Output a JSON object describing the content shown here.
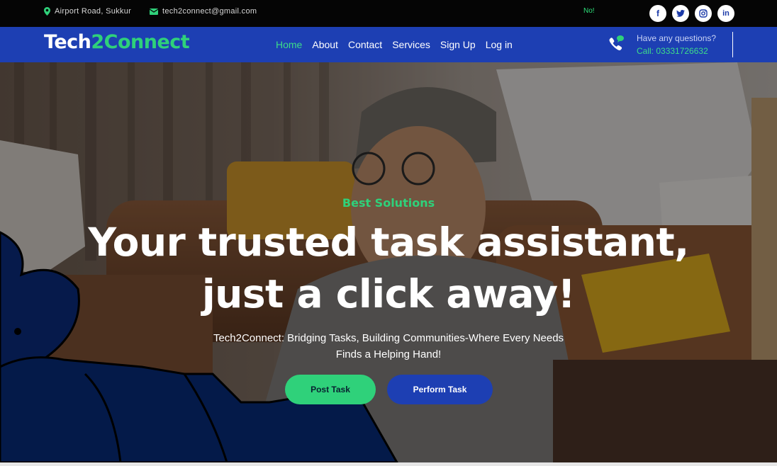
{
  "topbar": {
    "address": "Airport Road, Sukkur",
    "email": "tech2connect@gmail.com",
    "notice": "No!",
    "socials": [
      "facebook-icon",
      "twitter-icon",
      "instagram-icon",
      "linkedin-icon"
    ]
  },
  "nav": {
    "brand_main": "Tech",
    "brand_accent": "2Connect",
    "items": [
      {
        "label": "Home",
        "active": true
      },
      {
        "label": "About"
      },
      {
        "label": "Contact"
      },
      {
        "label": "Services"
      },
      {
        "label": "Sign Up"
      },
      {
        "label": "Log in"
      }
    ],
    "question": "Have any questions?",
    "call": "Call: 03331726632"
  },
  "hero": {
    "eyebrow": "Best Solutions",
    "headline": "Your trusted task assistant, just a click away!",
    "subtitle": "Tech2Connect: Bridging Tasks, Building Communities-Where Every Needs Finds a Helping Hand!",
    "post_label": "Post Task",
    "perform_label": "Perform Task"
  },
  "colors": {
    "primary": "#1d3fb3",
    "accent": "#2fd17a",
    "topbar": "#050505"
  }
}
